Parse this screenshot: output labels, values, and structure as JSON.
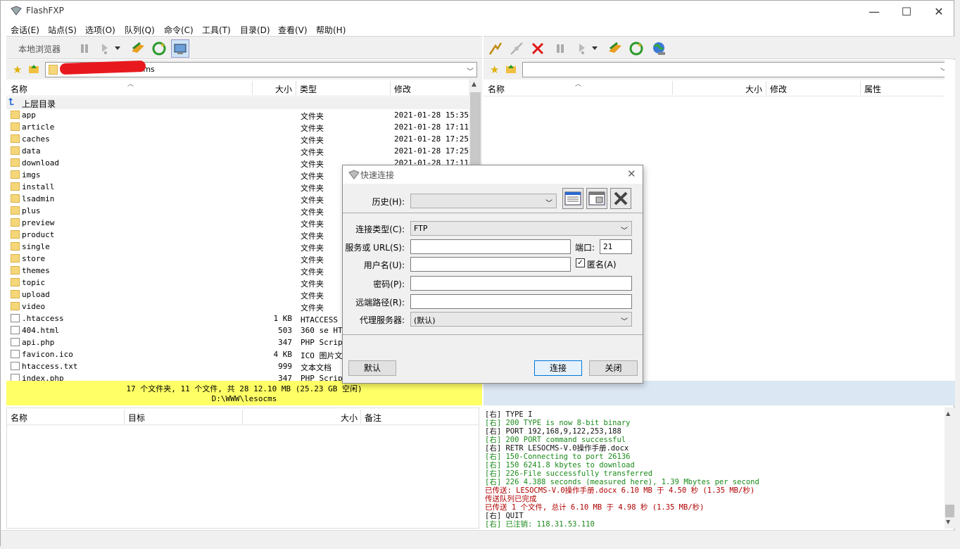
{
  "window": {
    "title": "FlashFXP"
  },
  "menu": [
    "会话(E)",
    "站点(S)",
    "选项(O)",
    "队列(Q)",
    "命令(C)",
    "工具(T)",
    "目录(D)",
    "查看(V)",
    "帮助(H)"
  ],
  "left_toolbar": {
    "browser_label": "本地浏览器"
  },
  "left_address": {
    "path_fragment": "lesocms"
  },
  "left_columns": [
    "名称",
    "大小",
    "类型",
    "修改"
  ],
  "right_columns": [
    "名称",
    "大小",
    "修改",
    "属性"
  ],
  "up_dir": "上层目录",
  "files": [
    {
      "name": "app",
      "size": "",
      "type": "文件夹",
      "date": "2021-01-28 15:35"
    },
    {
      "name": "article",
      "size": "",
      "type": "文件夹",
      "date": "2021-01-28 17:11"
    },
    {
      "name": "caches",
      "size": "",
      "type": "文件夹",
      "date": "2021-01-28 17:25"
    },
    {
      "name": "data",
      "size": "",
      "type": "文件夹",
      "date": "2021-01-28 17:25"
    },
    {
      "name": "download",
      "size": "",
      "type": "文件夹",
      "date": "2021-01-28 17:11"
    },
    {
      "name": "imgs",
      "size": "",
      "type": "文件夹",
      "date": ""
    },
    {
      "name": "install",
      "size": "",
      "type": "文件夹",
      "date": ""
    },
    {
      "name": "lsadmin",
      "size": "",
      "type": "文件夹",
      "date": ""
    },
    {
      "name": "plus",
      "size": "",
      "type": "文件夹",
      "date": ""
    },
    {
      "name": "preview",
      "size": "",
      "type": "文件夹",
      "date": ""
    },
    {
      "name": "product",
      "size": "",
      "type": "文件夹",
      "date": ""
    },
    {
      "name": "single",
      "size": "",
      "type": "文件夹",
      "date": ""
    },
    {
      "name": "store",
      "size": "",
      "type": "文件夹",
      "date": ""
    },
    {
      "name": "themes",
      "size": "",
      "type": "文件夹",
      "date": ""
    },
    {
      "name": "topic",
      "size": "",
      "type": "文件夹",
      "date": ""
    },
    {
      "name": "upload",
      "size": "",
      "type": "文件夹",
      "date": ""
    },
    {
      "name": "video",
      "size": "",
      "type": "文件夹",
      "date": ""
    },
    {
      "name": ".htaccess",
      "size": "1 KB",
      "type": "HTACCESS 文",
      "date": ""
    },
    {
      "name": "404.html",
      "size": "503",
      "type": "360 se HTM",
      "date": ""
    },
    {
      "name": "api.php",
      "size": "347",
      "type": "PHP Script",
      "date": ""
    },
    {
      "name": "favicon.ico",
      "size": "4 KB",
      "type": "ICO 图片文",
      "date": ""
    },
    {
      "name": "htaccess.txt",
      "size": "999",
      "type": "文本文档",
      "date": ""
    },
    {
      "name": "index.php",
      "size": "347",
      "type": "PHP Script",
      "date": ""
    }
  ],
  "status_left": {
    "line1": "17 个文件夹, 11 个文件, 共 28 12.10 MB (25.23 GB 空闲)",
    "line2": "D:\\WWW\\lesocms"
  },
  "queue_columns": [
    "名称",
    "目标",
    "大小",
    "备注"
  ],
  "log": [
    {
      "text": "[右] TYPE I",
      "cls": "lb"
    },
    {
      "text": "[右] 200 TYPE is now 8-bit binary",
      "cls": "lg"
    },
    {
      "text": "[右] PORT 192,168,9,122,253,188",
      "cls": "lb"
    },
    {
      "text": "[右] 200 PORT command successful",
      "cls": "lg"
    },
    {
      "text": "[右] RETR LESOCMS-V.0操作手册.docx",
      "cls": "lb"
    },
    {
      "text": "[右] 150-Connecting to port 26136",
      "cls": "lg"
    },
    {
      "text": "[右] 150 6241.8 kbytes to download",
      "cls": "lg"
    },
    {
      "text": "[右] 226-File successfully transferred",
      "cls": "lg"
    },
    {
      "text": "[右] 226 4.388 seconds (measured here), 1.39 Mbytes per second",
      "cls": "lg"
    },
    {
      "text": "已传送: LESOCMS-V.0操作手册.docx 6.10 MB 于 4.50 秒 (1.35 MB/秒)",
      "cls": "lr"
    },
    {
      "text": "传送队列已完成",
      "cls": "lr"
    },
    {
      "text": "已传送 1 个文件, 总计 6.10 MB 于 4.98 秒 (1.35 MB/秒)",
      "cls": "lr"
    },
    {
      "text": "[右] QUIT",
      "cls": "lb"
    },
    {
      "text": "[右] 已注销: 118.31.53.110",
      "cls": "lg"
    }
  ],
  "dialog": {
    "title": "快速连接",
    "history_label": "历史(H):",
    "conn_type_label": "连接类型(C):",
    "conn_type_value": "FTP",
    "server_label": "服务或 URL(S):",
    "port_label": "端口:",
    "port_value": "21",
    "user_label": "用户名(U):",
    "anon_label": "匿名(A)",
    "password_label": "密码(P):",
    "remote_label": "远端路径(R):",
    "proxy_label": "代理服务器:",
    "proxy_value": "(默认)",
    "default_btn": "默认",
    "connect_btn": "连接",
    "close_btn": "关闭"
  }
}
